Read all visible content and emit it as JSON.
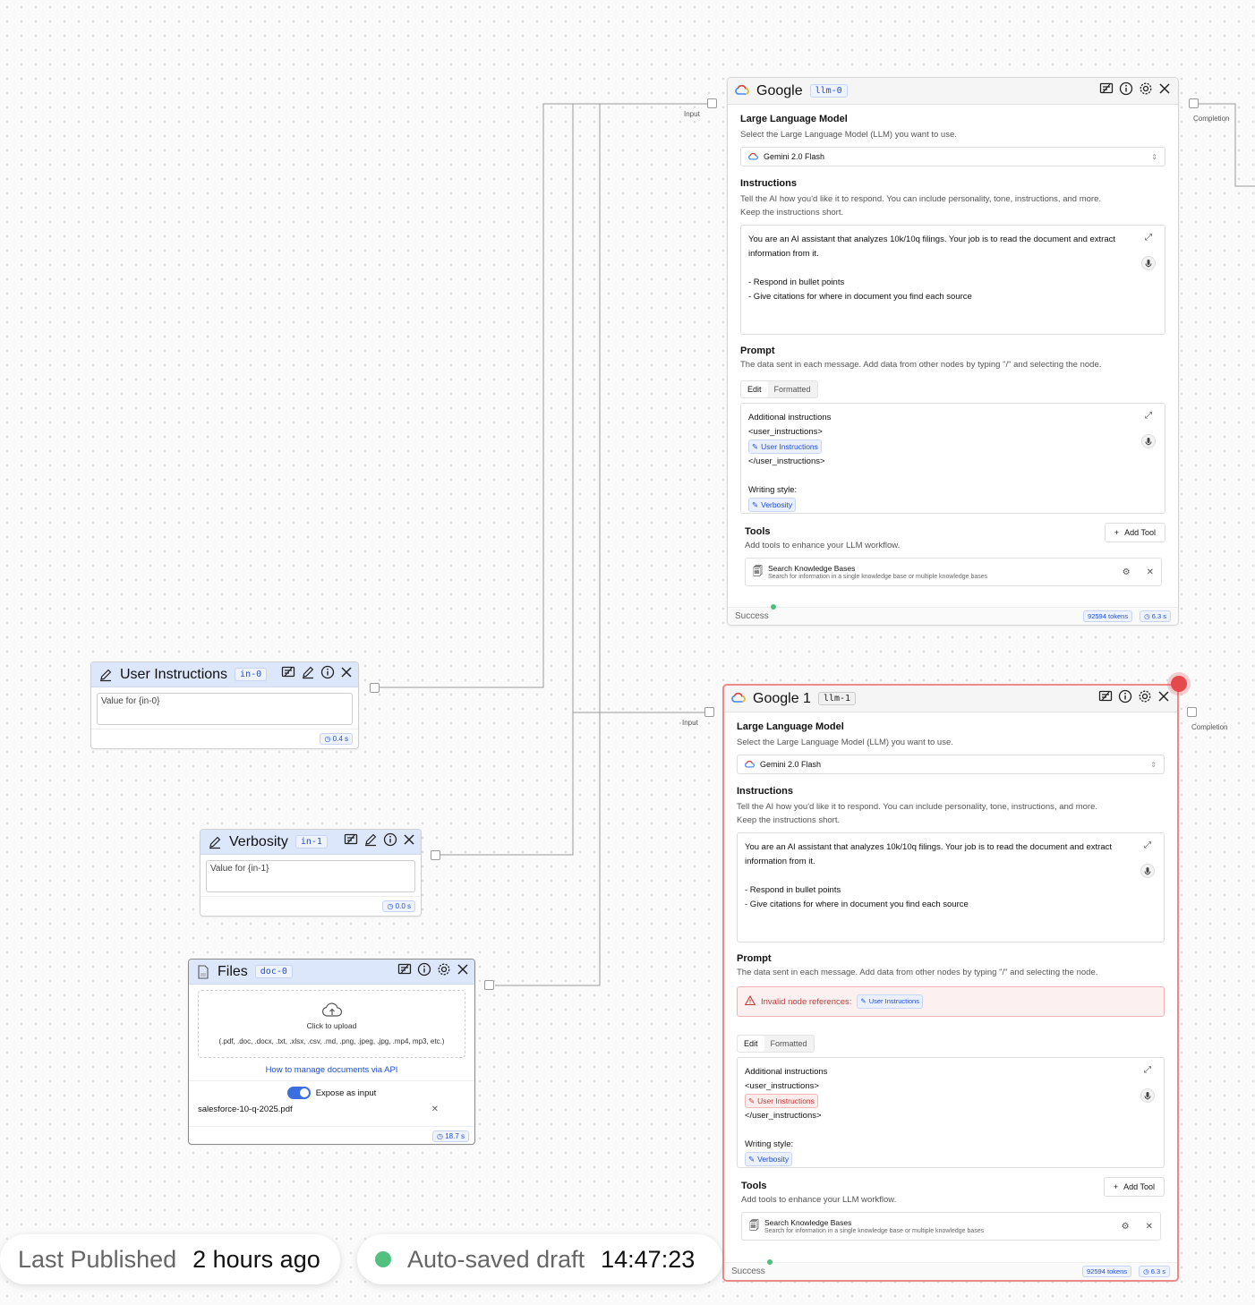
{
  "google0": {
    "title": "Google",
    "tag": "llm-0",
    "input_label": "Input",
    "completion_label": "Completion",
    "llm_section": "Large Language Model",
    "llm_desc": "Select the Large Language Model (LLM) you want to use.",
    "model": "Gemini 2.0 Flash",
    "instructions_title": "Instructions",
    "instructions_desc1": "Tell the AI how you'd like it to respond. You can include personality, tone, instructions, and more.",
    "instructions_desc2": "Keep the instructions short.",
    "instr_line1": "You are an AI assistant that analyzes 10k/10q filings. Your job is to read the document and extract",
    "instr_line2": "information from it.",
    "instr_line3": "- Respond in bullet points",
    "instr_line4": "- Give citations for where in document you find each source",
    "prompt_title": "Prompt",
    "prompt_desc": "The data sent in each message. Add data from other nodes by typing \"/\" and selecting the node.",
    "tab_edit": "Edit",
    "tab_formatted": "Formatted",
    "p_line1": "Additional instructions",
    "p_line2": "<user_instructions>",
    "p_chip1": "User Instructions",
    "p_line3": "</user_instructions>",
    "p_line4": "Writing style:",
    "p_chip2": "Verbosity",
    "tools_title": "Tools",
    "tools_desc": "Add tools to enhance your LLM workflow.",
    "add_tool": "Add Tool",
    "tool_name": "Search Knowledge Bases",
    "tool_desc": "Search for information in a single knowledge base or multiple knowledge bases",
    "status": "Success",
    "tokens": "92594 tokens",
    "time": "6.3 s"
  },
  "google1": {
    "title": "Google 1",
    "tag": "llm-1",
    "input_label": "Input",
    "completion_label": "Completion",
    "llm_section": "Large Language Model",
    "llm_desc": "Select the Large Language Model (LLM) you want to use.",
    "model": "Gemini 2.0 Flash",
    "instructions_title": "Instructions",
    "instructions_desc1": "Tell the AI how you'd like it to respond. You can include personality, tone, instructions, and more.",
    "instructions_desc2": "Keep the instructions short.",
    "instr_line1": "You are an AI assistant that analyzes 10k/10q filings. Your job is to read the document and extract",
    "instr_line2": "information from it.",
    "instr_line3": "- Respond in bullet points",
    "instr_line4": "- Give citations for where in document you find each source",
    "prompt_title": "Prompt",
    "prompt_desc": "The data sent in each message. Add data from other nodes by typing \"/\" and selecting the node.",
    "error_text": "Invalid node references:",
    "error_chip": "User Instructions",
    "tab_edit": "Edit",
    "tab_formatted": "Formatted",
    "p_line1": "Additional instructions",
    "p_line2": "<user_instructions>",
    "p_chip1": "User Instructions",
    "p_line3": "</user_instructions>",
    "p_line4": "Writing style:",
    "p_chip2": "Verbosity",
    "tools_title": "Tools",
    "tools_desc": "Add tools to enhance your LLM workflow.",
    "add_tool": "Add Tool",
    "tool_name": "Search Knowledge Bases",
    "tool_desc": "Search for information in a single knowledge base or multiple knowledge bases",
    "status": "Success",
    "tokens": "92594 tokens",
    "time": "6.3 s"
  },
  "user_instructions": {
    "title": "User Instructions",
    "tag": "in-0",
    "placeholder": "Value for {in-0}",
    "time": "0.4 s"
  },
  "verbosity": {
    "title": "Verbosity",
    "tag": "in-1",
    "placeholder": "Value for {in-1}",
    "time": "0.0 s"
  },
  "files": {
    "title": "Files",
    "tag": "doc-0",
    "upload_label": "Click to upload",
    "formats": "(.pdf, .doc, .docx, .txt, .xlsx, .csv, .md, .png, .jpeg, .jpg, .mp4, mp3, etc.)",
    "manage_link": "How to manage documents via API",
    "expose_label": "Expose as input",
    "file_name": "salesforce-10-q-2025.pdf",
    "time": "18.7 s"
  },
  "bottom": {
    "published_label": "Last Published",
    "published_value": "2 hours ago",
    "draft_label": "Auto-saved draft",
    "draft_time": "14:47:23"
  },
  "colors": {
    "accent": "#1d4ed8",
    "header_blue": "#dde7fb",
    "error_red": "#e5484d",
    "success_green": "#4cc07a"
  }
}
